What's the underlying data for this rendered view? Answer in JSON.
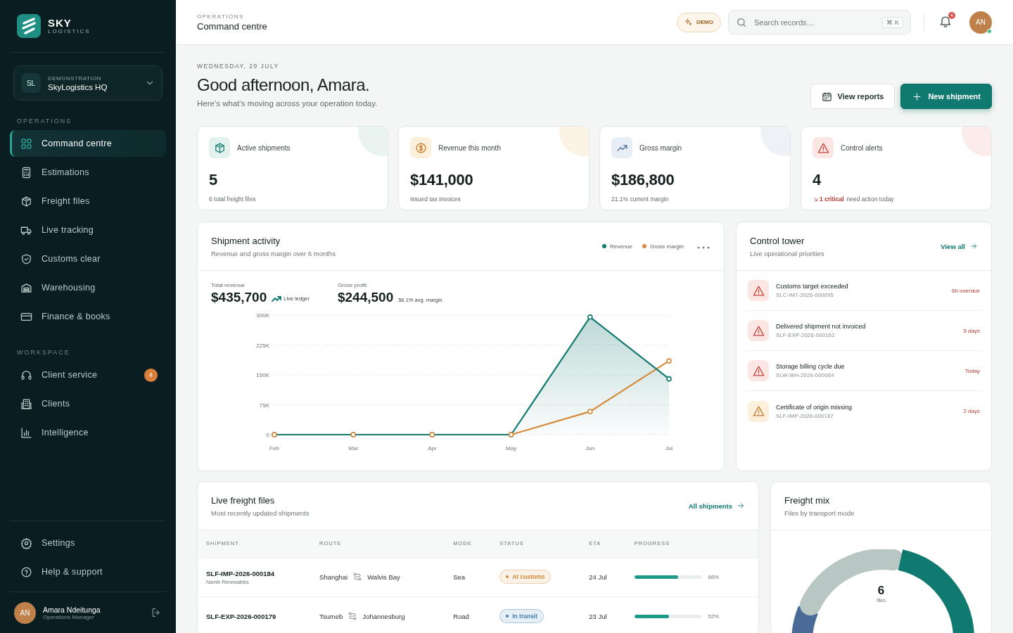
{
  "brand": {
    "name": "SKY",
    "tagline": "LOGISTICS"
  },
  "org": {
    "initials": "SL",
    "label": "DEMONSTRATION",
    "name": "SkyLogistics HQ"
  },
  "sidebar": {
    "sections": [
      {
        "title": "OPERATIONS",
        "items": [
          {
            "label": "Command centre",
            "selected": true
          },
          {
            "label": "Estimations",
            "selected": false
          },
          {
            "label": "Freight files",
            "selected": false
          },
          {
            "label": "Live tracking",
            "selected": false
          },
          {
            "label": "Customs clear",
            "selected": false
          },
          {
            "label": "Warehousing",
            "selected": false
          },
          {
            "label": "Finance & books",
            "selected": false
          }
        ]
      },
      {
        "title": "WORKSPACE",
        "items": [
          {
            "label": "Client service",
            "selected": false,
            "badge": "4"
          },
          {
            "label": "Clients",
            "selected": false
          },
          {
            "label": "Intelligence",
            "selected": false
          }
        ]
      }
    ],
    "footer_items": [
      {
        "label": "Settings",
        "selected": false
      },
      {
        "label": "Help & support",
        "selected": false
      }
    ],
    "user": {
      "initials": "AN",
      "name": "Amara Ndeitunga",
      "role": "Operations Manager"
    }
  },
  "header": {
    "section": "OPERATIONS",
    "title": "Command centre",
    "demo_badge": "DEMO",
    "search": {
      "placeholder": "Search records…",
      "shortcut": "⌘ K"
    },
    "notifications": "4",
    "avatar": "AN",
    "online": true
  },
  "greeting": {
    "date": "WEDNESDAY, 29 JULY",
    "title": "Good afternoon, Amara.",
    "subtitle": "Here’s what’s moving across your operation today.",
    "buttons": [
      {
        "label": "View reports",
        "kind": "secondary"
      },
      {
        "label": "New shipment",
        "kind": "primary"
      }
    ]
  },
  "kpis": [
    {
      "label": "Active shipments",
      "value": "5",
      "note": "6 total freight files",
      "kind": "teal"
    },
    {
      "label": "Revenue this month",
      "value": "$141,000",
      "note": "Issued tax invoices",
      "kind": "amber"
    },
    {
      "label": "Gross margin",
      "value": "$186,800",
      "note": "21.1% current margin",
      "kind": "blue"
    },
    {
      "label": "Control alerts",
      "value": "4",
      "highlight": "1 critical",
      "note": "need action today",
      "kind": "red"
    }
  ],
  "shipment_activity": {
    "title": "Shipment activity",
    "subtitle": "Revenue and gross margin over 6 months",
    "stats": [
      {
        "label": "Total revenue",
        "value": "$435,700",
        "note": "Live ledger",
        "trend": true
      },
      {
        "label": "Gross profit",
        "value": "$244,500",
        "note": "56.1% avg. margin",
        "trend": false
      }
    ],
    "chart_data": {
      "type": "line",
      "grid": true,
      "categories": [
        "Feb",
        "Mar",
        "Apr",
        "May",
        "Jun",
        "Jul"
      ],
      "series": [
        {
          "name": "Revenue",
          "color": "#137a70",
          "marker": true,
          "values": [
            0,
            0,
            0,
            0,
            295000,
            140000
          ]
        },
        {
          "name": "Gross margin",
          "color": "#d68a3c",
          "marker": true,
          "values": [
            0,
            0,
            0,
            0,
            58000,
            185000
          ]
        }
      ],
      "ylim": [
        0,
        300000
      ],
      "yticks": [
        {
          "value": 0,
          "label": "0"
        },
        {
          "value": 75000,
          "label": "75K"
        },
        {
          "value": 150000,
          "label": "150K"
        },
        {
          "value": 225000,
          "label": "225K"
        },
        {
          "value": 300000,
          "label": "300K"
        }
      ]
    }
  },
  "control_tower": {
    "title": "Control tower",
    "subtitle": "Live operational priorities",
    "link": "View all",
    "items": [
      {
        "title": "Customs target exceeded",
        "ref": "SLC-IM7-2026-000095",
        "due": "6h overdue",
        "kind": "critical"
      },
      {
        "title": "Delivered shipment not invoiced",
        "ref": "SLF-EXP-2026-000162",
        "due": "5 days",
        "kind": "critical"
      },
      {
        "title": "Storage billing cycle due",
        "ref": "SLW-WH-2026-000064",
        "due": "Today",
        "kind": "critical"
      },
      {
        "title": "Certificate of origin missing",
        "ref": "SLF-IMP-2026-000187",
        "due": "2 days",
        "kind": "warning"
      }
    ]
  },
  "freight_files": {
    "title": "Live freight files",
    "subtitle": "Most recently updated shipments",
    "link": "All shipments",
    "columns": [
      "SHIPMENT",
      "ROUTE",
      "MODE",
      "STATUS",
      "ETA",
      "PROGRESS"
    ],
    "rows": [
      {
        "shipment": "SLF-IMP-2026-000184",
        "client": "Namib Renewables",
        "origin": "Shanghai",
        "destination": "Walvis Bay",
        "mode": "Sea",
        "status": "At customs",
        "color": "#d68a3c",
        "eta": "24 Jul",
        "level": 0.66,
        "percent": "66%"
      },
      {
        "shipment": "SLF-EXP-2026-000179",
        "origin": "Tsumeb",
        "destination": "Johannesburg",
        "mode": "Road",
        "status": "In transit",
        "color": "#3d7fb5",
        "eta": "23 Jul",
        "level": 0.52,
        "percent": "52%"
      }
    ]
  },
  "freight_mix": {
    "title": "Freight mix",
    "subtitle": "Files by transport mode",
    "total": "6",
    "total_label": "files"
  }
}
